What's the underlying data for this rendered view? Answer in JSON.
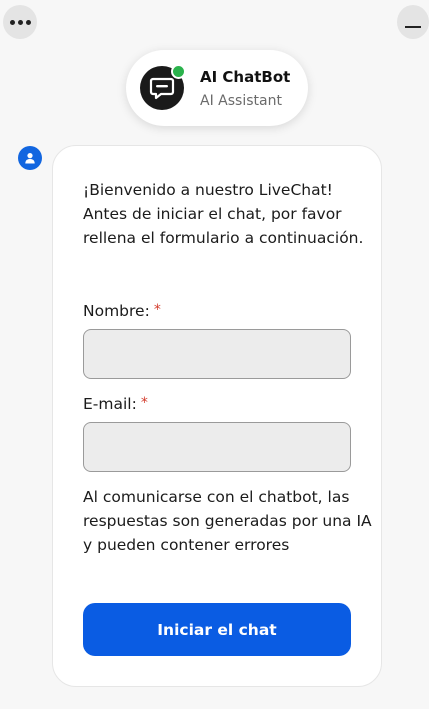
{
  "header": {
    "bot_name": "AI ChatBot",
    "bot_subtitle": "AI Assistant",
    "status": "online"
  },
  "window": {
    "menu_icon": "more-horizontal-icon",
    "minimize_icon": "minimize-icon"
  },
  "message": {
    "welcome_text": "¡Bienvenido a nuestro LiveChat! Antes de iniciar el chat, por favor rellena el formulario a continuación.",
    "disclaimer": "Al comunicarse con el chatbot, las respuestas son generadas por una IA y pueden contener errores"
  },
  "form": {
    "name_label": "Nombre:",
    "name_value": "",
    "email_label": "E-mail:",
    "email_value": "",
    "required_marker": "*",
    "submit_label": "Iniciar el chat"
  },
  "colors": {
    "accent": "#0a5ce3",
    "online": "#2bb24c",
    "required": "#d33b2c"
  }
}
